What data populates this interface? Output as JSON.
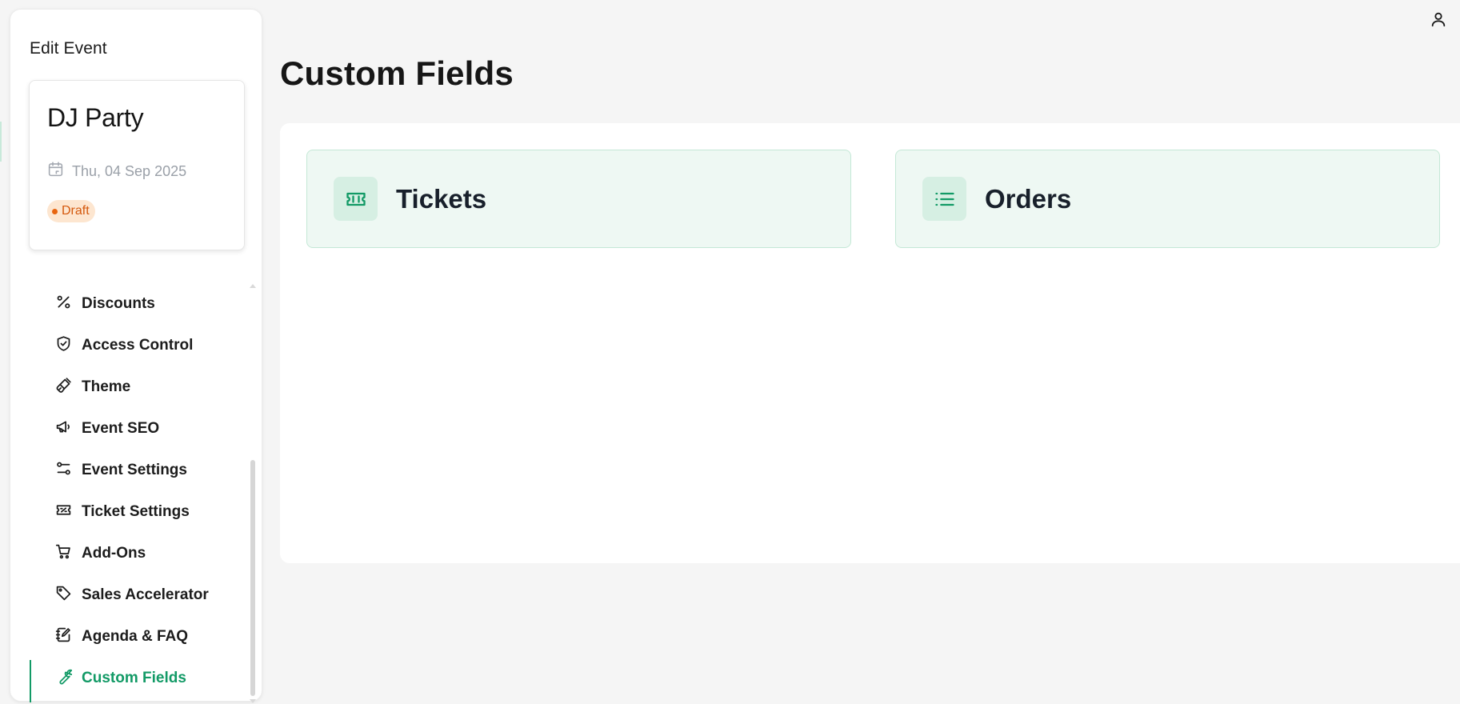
{
  "sidebar": {
    "title": "Edit Event",
    "event": {
      "name": "DJ Party",
      "date": "Thu, 04 Sep 2025",
      "status": "Draft",
      "status_color": "#e8650f"
    },
    "nav": [
      {
        "label": "Discounts",
        "icon": "percent-icon"
      },
      {
        "label": "Access Control",
        "icon": "shield-check-icon"
      },
      {
        "label": "Theme",
        "icon": "paintbrush-icon"
      },
      {
        "label": "Event SEO",
        "icon": "megaphone-icon"
      },
      {
        "label": "Event Settings",
        "icon": "settings-sliders-icon"
      },
      {
        "label": "Ticket Settings",
        "icon": "ticket-icon"
      },
      {
        "label": "Add-Ons",
        "icon": "shopping-cart-icon"
      },
      {
        "label": "Sales Accelerator",
        "icon": "tag-icon"
      },
      {
        "label": "Agenda & FAQ",
        "icon": "notebook-pen-icon"
      },
      {
        "label": "Custom Fields",
        "icon": "wrench-icon",
        "active": true
      }
    ]
  },
  "header": {
    "user_icon": "user-icon"
  },
  "main": {
    "title": "Custom Fields",
    "options": [
      {
        "label": "Tickets",
        "icon": "ticket-icon"
      },
      {
        "label": "Orders",
        "icon": "list-icon"
      }
    ]
  },
  "colors": {
    "accent": "#129a66",
    "card_bg": "#eef8f3",
    "card_border": "#c4e8d6",
    "draft_badge_bg": "#fde6d0"
  }
}
